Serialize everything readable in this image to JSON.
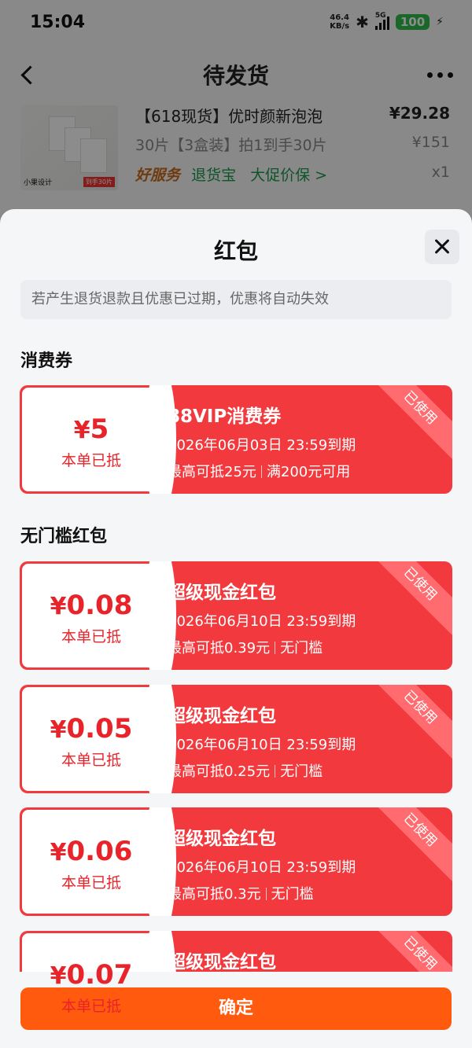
{
  "status_bar": {
    "time": "15:04",
    "net_speed_value": "46.4",
    "net_speed_unit": "KB/s",
    "network": "5G",
    "battery": "100"
  },
  "nav": {
    "title": "待发货"
  },
  "order_item": {
    "thumb_brand": "小果设计",
    "thumb_tag": "到手30片",
    "title": "【618现货】优时颜新泡泡",
    "price": "¥29.28",
    "sku": "30片【3盒装】拍1到手30片",
    "original_price": "¥151",
    "service_badge": "好服务",
    "service_1": "退货宝",
    "service_2": "大促价保 >",
    "quantity": "x1"
  },
  "sheet": {
    "title": "红包",
    "notice": "若产生退货退款且优惠已过期，优惠将自动失效",
    "section_consumer": "消费券",
    "section_no_threshold": "无门槛红包",
    "confirm_label": "确定"
  },
  "coupons": [
    {
      "amount": "5",
      "currency": "¥",
      "applied_label": "本单已抵",
      "name": "88VIP消费券",
      "expiry": "2026年06月03日 23:59到期",
      "max_deduct": "最高可抵25元",
      "condition": "满200元可用",
      "status": "已使用"
    },
    {
      "amount": "0.08",
      "currency": "¥",
      "applied_label": "本单已抵",
      "name": "超级现金红包",
      "expiry": "2026年06月10日 23:59到期",
      "max_deduct": "最高可抵0.39元",
      "condition": "无门槛",
      "status": "已使用"
    },
    {
      "amount": "0.05",
      "currency": "¥",
      "applied_label": "本单已抵",
      "name": "超级现金红包",
      "expiry": "2026年06月10日 23:59到期",
      "max_deduct": "最高可抵0.25元",
      "condition": "无门槛",
      "status": "已使用"
    },
    {
      "amount": "0.06",
      "currency": "¥",
      "applied_label": "本单已抵",
      "name": "超级现金红包",
      "expiry": "2026年06月10日 23:59到期",
      "max_deduct": "最高可抵0.3元",
      "condition": "无门槛",
      "status": "已使用"
    },
    {
      "amount": "0.07",
      "currency": "¥",
      "applied_label": "本单已抵",
      "name": "超级现金红包",
      "expiry": "",
      "max_deduct": "",
      "condition": "",
      "status": "已使用"
    }
  ],
  "colors": {
    "coupon_red": "#f23a3e",
    "amount_red": "#e8232a",
    "confirm_orange": "#ff5a0d",
    "battery_green": "#2ebd4e"
  }
}
